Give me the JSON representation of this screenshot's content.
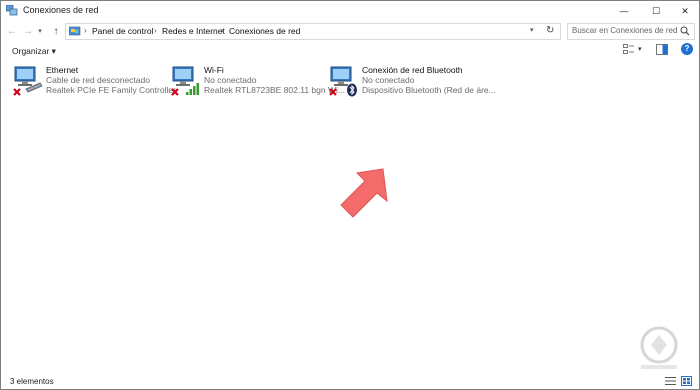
{
  "window": {
    "title": "Conexiones de red",
    "controls": {
      "minimize": "—",
      "maximize": "☐",
      "close": "✕"
    }
  },
  "nav": {
    "back": "←",
    "forward": "→",
    "recent": "▾",
    "up": "↑"
  },
  "address": {
    "crumbs": [
      "Panel de control",
      "Redes e Internet",
      "Conexiones de red"
    ],
    "separator": "›",
    "dropdown": "▾",
    "refresh": "↻"
  },
  "search": {
    "placeholder": "Buscar en Conexiones de red"
  },
  "commandbar": {
    "organize": "Organizar ▾",
    "view_dropdown": "▾",
    "help": "?"
  },
  "items": [
    {
      "name": "Ethernet",
      "status": "Cable de red desconectado",
      "device": "Realtek PCIe FE Family Controller",
      "icon": "ethernet-adapter-icon",
      "overlay": "red-x-icon"
    },
    {
      "name": "Wi-Fi",
      "status": "No conectado",
      "device": "Realtek RTL8723BE 802.11 bgn Wi...",
      "icon": "wifi-adapter-icon",
      "overlay": "signal-bars-icon"
    },
    {
      "name": "Conexión de red Bluetooth",
      "status": "No conectado",
      "device": "Dispositivo Bluetooth (Red de áre...",
      "icon": "bluetooth-adapter-icon",
      "overlay": "bluetooth-icon"
    }
  ],
  "statusbar": {
    "count": "3 elementos"
  },
  "colors": {
    "accent_blue": "#1d6fd0",
    "error_red": "#d0021b",
    "signal_green": "#3a9a2e",
    "arrow_pink": "#f46b6b",
    "secondary_text": "#6d6d6d"
  }
}
